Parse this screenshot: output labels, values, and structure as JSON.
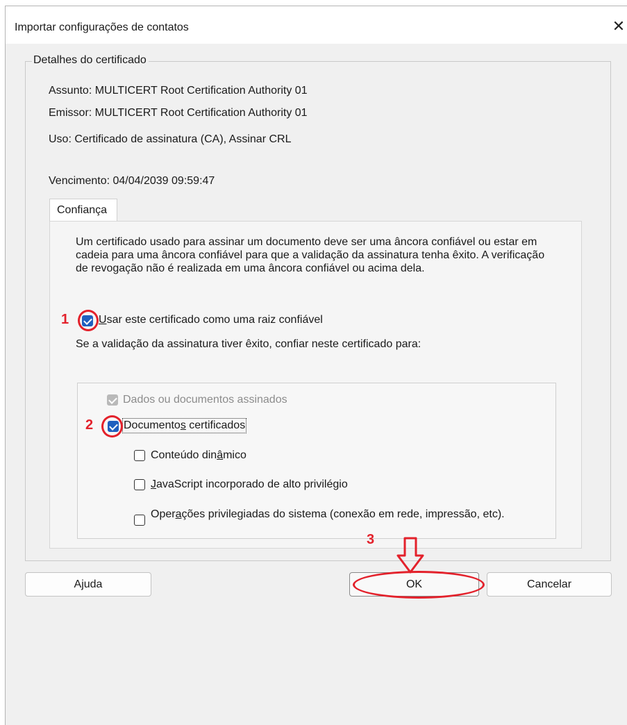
{
  "window": {
    "title": "Importar configurações de contatos",
    "close_glyph": "✕"
  },
  "details": {
    "legend": "Detalhes do certificado",
    "subject": "Assunto:  MULTICERT Root Certification Authority 01",
    "issuer": "Emissor:  MULTICERT Root Certification Authority 01",
    "usage": "Uso:  Certificado de assinatura (CA), Assinar CRL",
    "expiration": "Vencimento:  04/04/2039 09:59:47"
  },
  "tabs": [
    {
      "label": "Confiança",
      "selected": true
    }
  ],
  "trust": {
    "description": "Um certificado usado para assinar um documento deve ser uma âncora confiável ou estar em cadeia para uma âncora confiável para que a validação da assinatura tenha êxito. A verificação de revogação não é realizada em uma âncora confiável ou acima dela.",
    "root_checkbox": {
      "label_underline": "U",
      "label_rest": "sar este certificado como uma raiz confiável",
      "checked": true
    },
    "trust_for_text": "Se a validação da assinatura tiver êxito, confiar neste certificado para:",
    "options": {
      "signed_docs": {
        "label": "Dados ou documentos assinados",
        "checked": true,
        "disabled": true
      },
      "certified_docs": {
        "label_pre": "Documento",
        "label_underline": "s",
        "label_post": " certificados",
        "checked": true
      },
      "dynamic_content": {
        "label_pre": "Conteúdo din",
        "label_underline": "â",
        "label_post": "mico",
        "checked": false
      },
      "javascript": {
        "label_underline": "J",
        "label_rest": "avaScript incorporado de alto privilégio",
        "checked": false
      },
      "system_ops": {
        "label_pre": "Oper",
        "label_underline": "a",
        "label_post": "ções privilegiadas do sistema (conexão em rede, impressão, etc).",
        "checked": false
      }
    }
  },
  "buttons": {
    "help": "Ajuda",
    "ok": "OK",
    "cancel": "Cancelar"
  },
  "annotations": {
    "step1": "1",
    "step2": "2",
    "step3": "3",
    "color": "#e3212b"
  }
}
